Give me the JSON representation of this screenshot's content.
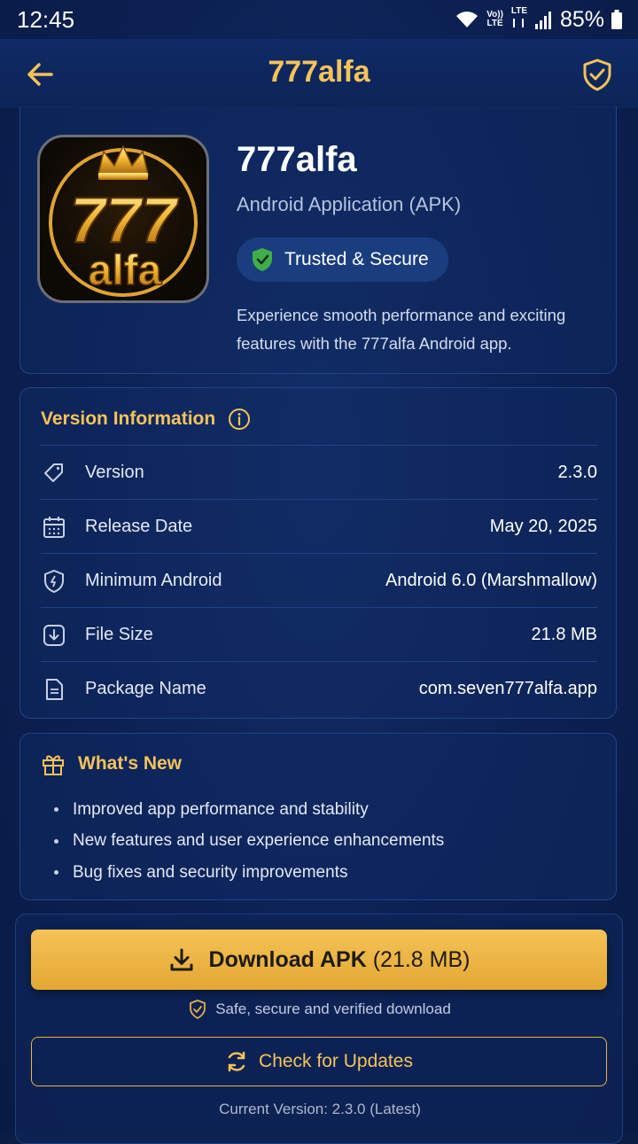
{
  "status_bar": {
    "time": "12:45",
    "network_top": "Vo))",
    "network_bottom": "LTE",
    "network2_top": "LTE",
    "battery_percent": "85%"
  },
  "header": {
    "title": "777alfa",
    "back_icon": "arrow-left-icon",
    "shield_icon": "shield-check-icon"
  },
  "app": {
    "name": "777alfa",
    "type": "Android Application (APK)",
    "badge": "Trusted & Secure",
    "description": "Experience smooth performance and exciting features with the 777alfa Android app.",
    "logo_text_top": "777",
    "logo_text_bottom": "alfa"
  },
  "version_info": {
    "title": "Version Information",
    "rows": [
      {
        "icon": "tag-icon",
        "label": "Version",
        "value": "2.3.0"
      },
      {
        "icon": "calendar-icon",
        "label": "Release Date",
        "value": "May 20, 2025"
      },
      {
        "icon": "android-shield-icon",
        "label": "Minimum Android",
        "value": "Android 6.0 (Marshmallow)"
      },
      {
        "icon": "download-circle-icon",
        "label": "File Size",
        "value": "21.8 MB"
      },
      {
        "icon": "document-icon",
        "label": "Package Name",
        "value": "com.seven777alfa.app"
      }
    ]
  },
  "whats_new": {
    "title": "What's New",
    "items": [
      "Improved app performance and stability",
      "New features and user experience enhancements",
      "Bug fixes and security improvements"
    ]
  },
  "download": {
    "button_bold": "Download APK",
    "button_size": "(21.8 MB)",
    "safe_note": "Safe, secure and verified download",
    "check_updates": "Check for Updates",
    "current_version": "Current Version: 2.3.0 (Latest)"
  },
  "colors": {
    "accent_gold": "#f5c35a",
    "background": "#0c2052",
    "badge_green": "#3fae4a"
  }
}
